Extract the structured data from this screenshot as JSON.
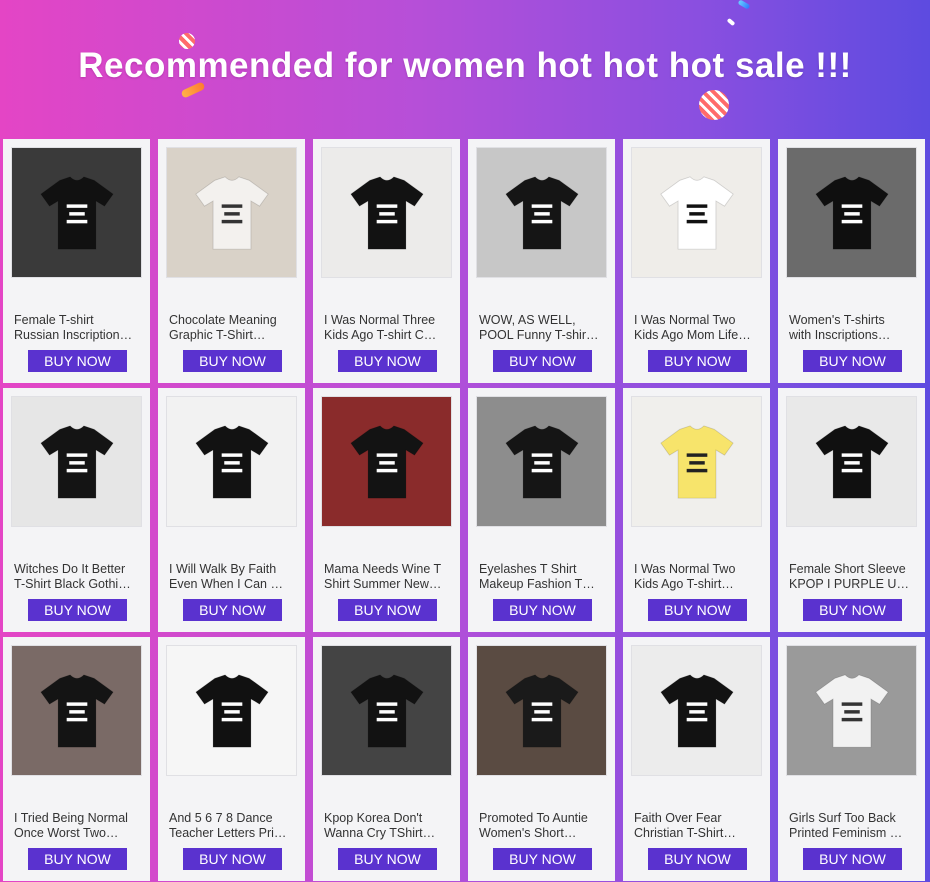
{
  "banner": {
    "title": "Recommended for women hot hot hot sale !!!"
  },
  "buy_label": "BUY NOW",
  "products": [
    {
      "line1": "Female T-shirt",
      "line2": "Russian Inscription…",
      "thumb_bg": "#3a3a3a",
      "shirt": "#111111",
      "print": "#ffffff"
    },
    {
      "line1": "Chocolate Meaning",
      "line2": "Graphic T-Shirt…",
      "thumb_bg": "#d9d2c8",
      "shirt": "#f3f1ee",
      "print": "#333333"
    },
    {
      "line1": "I Was Normal Three",
      "line2": "Kids Ago T-shirt C…",
      "thumb_bg": "#ecebea",
      "shirt": "#121212",
      "print": "#ffffff"
    },
    {
      "line1": "WOW, AS WELL,",
      "line2": "POOL Funny T-shir…",
      "thumb_bg": "#c7c7c7",
      "shirt": "#151515",
      "print": "#ffffff"
    },
    {
      "line1": "I Was Normal Two",
      "line2": "Kids Ago Mom Life…",
      "thumb_bg": "#efede9",
      "shirt": "#ffffff",
      "print": "#111111"
    },
    {
      "line1": "Women's T-shirts",
      "line2": "with Inscriptions…",
      "thumb_bg": "#6b6b6b",
      "shirt": "#0f0f0f",
      "print": "#ffffff"
    },
    {
      "line1": "Witches Do It Better",
      "line2": "T-Shirt Black Gothi…",
      "thumb_bg": "#e6e6e6",
      "shirt": "#141414",
      "print": "#ffffff"
    },
    {
      "line1": "I Will Walk By Faith",
      "line2": "Even When I Can …",
      "thumb_bg": "#f2f2f2",
      "shirt": "#121212",
      "print": "#ffffff"
    },
    {
      "line1": "Mama Needs Wine T",
      "line2": "Shirt Summer New…",
      "thumb_bg": "#8a2b2b",
      "shirt": "#131313",
      "print": "#ffffff"
    },
    {
      "line1": "Eyelashes T Shirt",
      "line2": "Makeup Fashion T…",
      "thumb_bg": "#8d8d8d",
      "shirt": "#151515",
      "print": "#ffffff"
    },
    {
      "line1": "I Was Normal Two",
      "line2": "Kids Ago T-shirt…",
      "thumb_bg": "#f0efec",
      "shirt": "#f7e46b",
      "print": "#222222"
    },
    {
      "line1": "Female Short Sleeve",
      "line2": "KPOP I PURPLE U…",
      "thumb_bg": "#e9e9e9",
      "shirt": "#101010",
      "print": "#ffffff"
    },
    {
      "line1": "I Tried Being Normal",
      "line2": "Once Worst Two…",
      "thumb_bg": "#7a6a66",
      "shirt": "#141414",
      "print": "#ffffff"
    },
    {
      "line1": "And 5 6 7 8 Dance",
      "line2": "Teacher Letters Pri…",
      "thumb_bg": "#f6f6f6",
      "shirt": "#111111",
      "print": "#ffffff"
    },
    {
      "line1": "Kpop Korea Don't",
      "line2": "Wanna Cry TShirt…",
      "thumb_bg": "#444444",
      "shirt": "#121212",
      "print": "#ffffff"
    },
    {
      "line1": "Promoted To Auntie",
      "line2": "Women's Short…",
      "thumb_bg": "#5a4b42",
      "shirt": "#1a1a1a",
      "print": "#ffffff"
    },
    {
      "line1": "Faith Over Fear",
      "line2": "Christian T-Shirt…",
      "thumb_bg": "#ececec",
      "shirt": "#121212",
      "print": "#ffffff"
    },
    {
      "line1": "Girls Surf Too Back",
      "line2": "Printed Feminism …",
      "thumb_bg": "#9a9a9a",
      "shirt": "#f2f2f2",
      "print": "#333333"
    }
  ]
}
